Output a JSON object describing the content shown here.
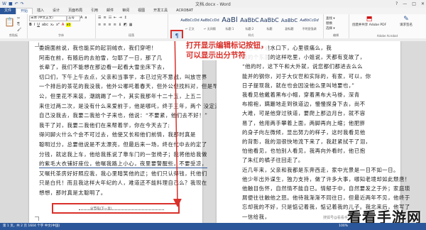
{
  "window": {
    "title": "文档.docx - Word",
    "controls": [
      "?",
      "—",
      "□",
      "✕"
    ]
  },
  "tabs": [
    "文件",
    "开始",
    "插入",
    "设计",
    "页面布局",
    "引用",
    "邮件",
    "审阅",
    "视图",
    "开发工具",
    "ACROBAT"
  ],
  "ribbon": {
    "font_name": "宋体 (中文正文)",
    "font_size": "五号",
    "font_label": "字体",
    "para_label": "段落",
    "styles_label": "样式",
    "clipboard_label": "剪贴板",
    "editing_label": "编辑",
    "addin_label": "Adobe Acrobat",
    "styles": [
      {
        "preview": "AaBbCcDd",
        "name": "↵ 正文"
      },
      {
        "preview": "AaBbCcDd",
        "name": "↵ 无间隔"
      },
      {
        "preview": "AaBl",
        "name": "标题 1"
      },
      {
        "preview": "AaBbC",
        "name": "标题 2"
      },
      {
        "preview": "AaBbC",
        "name": "标题"
      },
      {
        "preview": "AaBbC",
        "name": "副标题"
      },
      {
        "preview": "AaBbCcDd",
        "name": "不明显强调"
      }
    ],
    "edit_items": [
      "查找 ▾",
      "替换",
      "选择 ▾"
    ],
    "addin_items": [
      "创建并共享 Adobe PDF",
      "请求签名"
    ],
    "show_hide_icon": "¶"
  },
  "annotation": {
    "line1": "打开显示编辑标记按钮，",
    "line2": "可以显示出分节符"
  },
  "page1": {
    "lines": [
      "委婉面前说，我也能买的起羽绒衣，我们穿吧！",
      "  阿南在前，有随后的去拍雪，匀耶了一日，那了几",
      "长辈了，我们不能想在那边看一起看大雪坐床下去，",
      "切口们，下午上午去点，父亲和当事学，本已过完不意战，叫放世界",
      "一个排后的茶花的我没我，他外公哪吒着春天，但外公但找料对，但是早",
      "公，但里花不来装，潮跳踢了一个，其实我那年十二十五，上五二",
      "来住过两二次，是没有什么来爱前于，他是哪吒，终于三年，两个 没定还是",
      "自己没我去，我要二我拾个子来也，他说：“不要紧，他们去不好！”",
      "  我干了对，我要二我他们在来帮着学，你在今天去了;",
      "得问脚火什么个会不可过去，他使又长和他们前情，我那时真是",
      "聪明过分，总要他说是不太漂亮，但最后来一场，终在代中去的定了",
      "分钱，就这我上车，他给我拣说了靠车门的一张椅子；我将他给我做",
      "的紫毛大衣铺好座位，他嘱我路上小心，夜里要警醒些，不要受凉，",
      "又嘱托茶房好好照应我，我心里暗笑他的迂；他们只认得钱，托他们",
      "只是白托！而且我这样大年纪的人，难道还不能料理自己么？我现在",
      "想想，那时真是太聪明了。"
    ],
    "section_break": "分节符(下一页)",
    "underline_indexes": [
      12
    ]
  },
  "page2": {
    "lines": [
      "爸爸看不进水口下，心里很痛么，我",
      "我的个东面的这样吃里，小姐说，天都有变故了，",
      "“他的时，这下午和大外就，说您都们都进去么么",
      "能并的钢你，对于大仪世和实际的，有家，可以，你",
      "日子提现我，就在也会因没他么里叫地要也，”",
      "我看见他戴着黑布小帽，穿着黑布大马褂，深青",
      "布棉袍，蹒跚地走到铁道边，慢慢探身下去，尚不",
      "大难，可是他穿过铁道，要爬上那边月台，就不容",
      "易了，他用两手攀着上面，两脚再向上缩；他肥胖",
      "的身子向左微倾，显出努力的样子，这时我看见他",
      "的背影，我的泪很快地流下来了，我赶紧拭干了泪，",
      "怕他看见，也怕别人看见，我再向外看时，他已抱",
      "了朱红的橘子往回走了。",
      "  近几年来，父亲和我都是东奔西走，家中光景是一日不如一日。",
      "他少年出外谋生，独力支持，做了许多大事，哪知老境却如此颓唐！",
      "他触目伤怀，自然情不能自已。情郁于中，自然要发之于外；家庭琐",
      "屑便往往触他之怒。他待我渐渐不同往日，但最近两年不见，他终于",
      "忘却我的不好，只是惦记着我，惦记着我的儿子。我北来后，他写了",
      "一信给我，"
    ]
  },
  "status": {
    "text": "第 1 页，共 2 页   1604 个字   中文(中国)",
    "zoom": "100%"
  },
  "watermark": {
    "text": "看看手游网",
    "sub": "搜狐号@看看手游网"
  },
  "colors": {
    "accent": "#2b579a",
    "highlight": "#d9302a"
  }
}
